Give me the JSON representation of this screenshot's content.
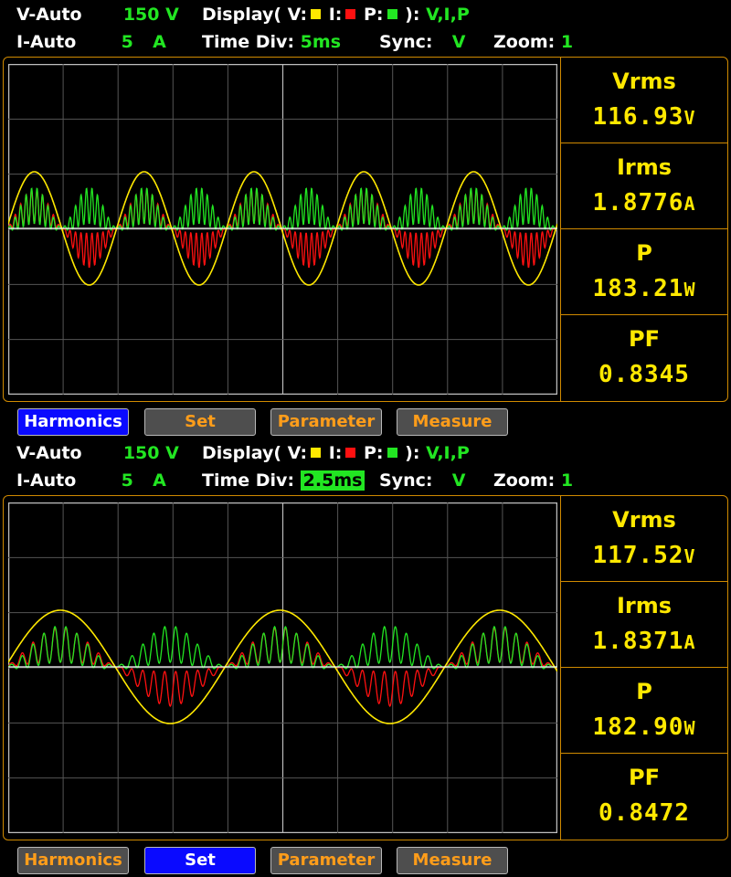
{
  "panels": [
    {
      "v_range_label": "V-Auto",
      "v_range_value": "150",
      "v_range_unit": "V",
      "i_range_label": "I-Auto",
      "i_range_value": "5",
      "i_range_unit": "A",
      "display_label": "Display( V:",
      "display_i_label": "I:",
      "display_p_label": "P:",
      "display_close": "):",
      "display_value": "V,I,P",
      "time_div_label": "Time  Div:",
      "time_div_value": "5ms",
      "time_div_highlight": false,
      "sync_label": "Sync:",
      "sync_value": "V",
      "zoom_label": "Zoom:",
      "zoom_value": "1",
      "measurements": [
        {
          "name": "Vrms",
          "value": "116.93",
          "unit": "V"
        },
        {
          "name": "Irms",
          "value": "1.8776",
          "unit": "A"
        },
        {
          "name": "P",
          "value": "183.21",
          "unit": "W"
        },
        {
          "name": "PF",
          "value": "0.8345",
          "unit": ""
        }
      ],
      "buttons": [
        {
          "label": "Harmonics",
          "active": true
        },
        {
          "label": "Set",
          "active": false
        },
        {
          "label": "Parameter",
          "active": false
        },
        {
          "label": "Measure",
          "active": false
        }
      ],
      "cycles": 5
    },
    {
      "v_range_label": "V-Auto",
      "v_range_value": "150",
      "v_range_unit": "V",
      "i_range_label": "I-Auto",
      "i_range_value": "5",
      "i_range_unit": "A",
      "display_label": "Display( V:",
      "display_i_label": "I:",
      "display_p_label": "P:",
      "display_close": "):",
      "display_value": "V,I,P",
      "time_div_label": "Time  Div:",
      "time_div_value": "2.5ms",
      "time_div_highlight": true,
      "sync_label": "Sync:",
      "sync_value": "V",
      "zoom_label": "Zoom:",
      "zoom_value": "1",
      "measurements": [
        {
          "name": "Vrms",
          "value": "117.52",
          "unit": "V"
        },
        {
          "name": "Irms",
          "value": "1.8371",
          "unit": "A"
        },
        {
          "name": "P",
          "value": "182.90",
          "unit": "W"
        },
        {
          "name": "PF",
          "value": "0.8472",
          "unit": ""
        }
      ],
      "buttons": [
        {
          "label": "Harmonics",
          "active": false
        },
        {
          "label": "Set",
          "active": true
        },
        {
          "label": "Parameter",
          "active": false
        },
        {
          "label": "Measure",
          "active": false
        }
      ],
      "cycles": 2.5
    }
  ],
  "colors": {
    "voltage": "#ffe800",
    "current": "#ff1010",
    "power": "#22e622",
    "accent_orange": "#d08a00",
    "button_active": "#0a0aff"
  }
}
